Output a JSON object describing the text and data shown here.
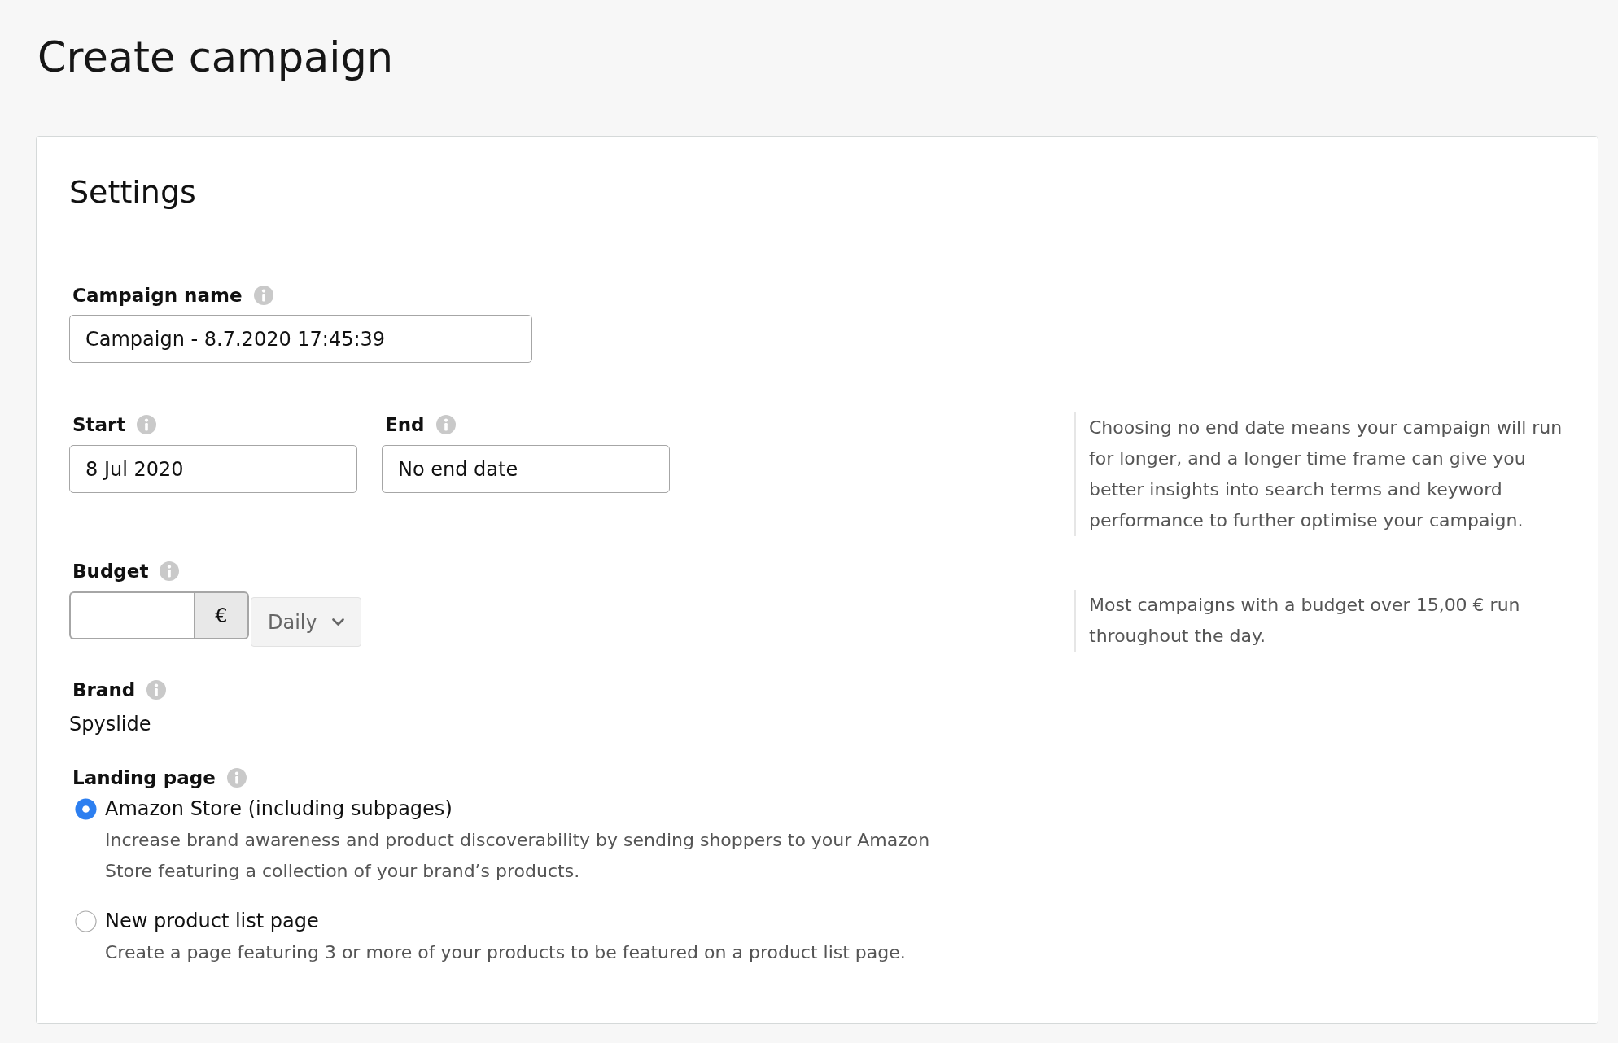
{
  "page": {
    "title": "Create campaign"
  },
  "settings": {
    "title": "Settings",
    "campaign_name": {
      "label": "Campaign name",
      "value": "Campaign - 8.7.2020 17:45:39"
    },
    "start": {
      "label": "Start",
      "value": "8 Jul 2020"
    },
    "end": {
      "label": "End",
      "value": "No end date"
    },
    "schedule_hint": "Choosing no end date means your campaign will run for longer, and a longer time frame can give you better insights into search terms and keyword performance to further optimise your campaign.",
    "budget": {
      "label": "Budget",
      "currency": "€",
      "period": "Daily"
    },
    "budget_hint": "Most campaigns with a budget over 15,00 € run throughout the day.",
    "brand": {
      "label": "Brand",
      "value": "Spyslide"
    },
    "landing_page": {
      "label": "Landing page",
      "options": [
        {
          "label": "Amazon Store (including subpages)",
          "description": "Increase brand awareness and product discoverability by sending shoppers to your Amazon Store featuring a collection of your brand’s products.",
          "selected": true
        },
        {
          "label": "New product list page",
          "description": "Create a page featuring 3 or more of your products to be featured on a product list page.",
          "selected": false
        }
      ]
    }
  }
}
